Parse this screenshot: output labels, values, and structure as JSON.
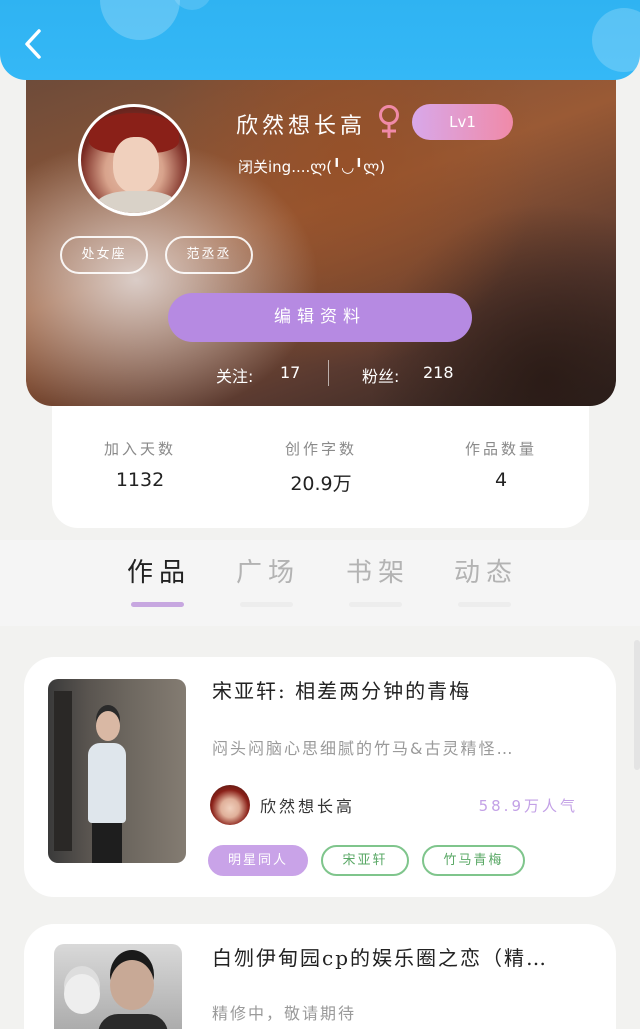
{
  "header": {
    "back_icon": "chevron-left-icon"
  },
  "profile": {
    "nickname": "欣然想长高",
    "gender_symbol": "♀",
    "level": "Lv1",
    "signature": "闭关ing....ლ(╹◡╹ლ)",
    "tags": [
      "处女座",
      "范丞丞"
    ],
    "edit_button": "编辑资料",
    "follow_label": "关注:",
    "follow_count": "17",
    "fans_label": "粉丝:",
    "fans_count": "218"
  },
  "stats": [
    {
      "label": "加入天数",
      "value": "1132"
    },
    {
      "label": "创作字数",
      "value": "20.9万"
    },
    {
      "label": "作品数量",
      "value": "4"
    }
  ],
  "tabs": [
    {
      "label": "作品",
      "active": true
    },
    {
      "label": "广场",
      "active": false
    },
    {
      "label": "书架",
      "active": false
    },
    {
      "label": "动态",
      "active": false
    }
  ],
  "works": [
    {
      "title": "宋亚轩: 相差两分钟的青梅",
      "description": "闷头闷脑心思细腻的竹马&古灵精怪…",
      "author": "欣然想长高",
      "popularity": "58.9万人气",
      "tags": [
        "明星同人",
        "宋亚轩",
        "竹马青梅"
      ]
    },
    {
      "title": "白刎伊甸园cp的娱乐圈之恋（精…",
      "description": "精修中，敬请期待"
    }
  ],
  "colors": {
    "header_blue": "#2fb3f2",
    "accent_purple": "#b68ae2",
    "tag_green": "#7fc58c",
    "popularity_purple": "#c3a1e6"
  }
}
